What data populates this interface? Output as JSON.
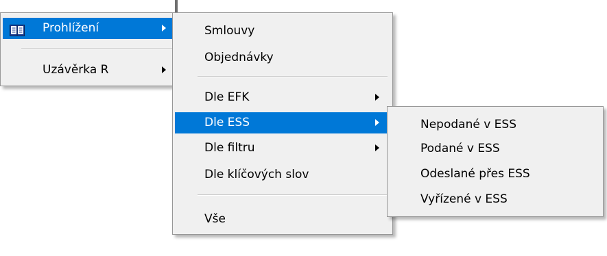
{
  "main_menu": {
    "items": [
      {
        "label": "Prohlížení",
        "icon": "book-icon",
        "has_submenu": true,
        "selected": true
      },
      {
        "label": "Uzávěrka R",
        "has_submenu": true,
        "selected": false
      }
    ]
  },
  "prohlizeni_submenu": {
    "items": [
      {
        "label": "Smlouvy"
      },
      {
        "label": "Objednávky"
      },
      {
        "label": "Dle EFK",
        "has_submenu": true
      },
      {
        "label": "Dle ESS",
        "has_submenu": true,
        "selected": true
      },
      {
        "label": "Dle filtru",
        "has_submenu": true
      },
      {
        "label": "Dle klíčových slov"
      },
      {
        "label": "Vše"
      }
    ]
  },
  "ess_submenu": {
    "items": [
      {
        "label": "Nepodané v ESS"
      },
      {
        "label": "Podané v ESS"
      },
      {
        "label": "Odeslané přes ESS"
      },
      {
        "label": "Vyřízené v ESS"
      }
    ]
  },
  "colors": {
    "menu_background": "#f0f0f0",
    "selection": "#0078d7",
    "selection_text": "#ffffff",
    "menu_border": "#979797"
  }
}
